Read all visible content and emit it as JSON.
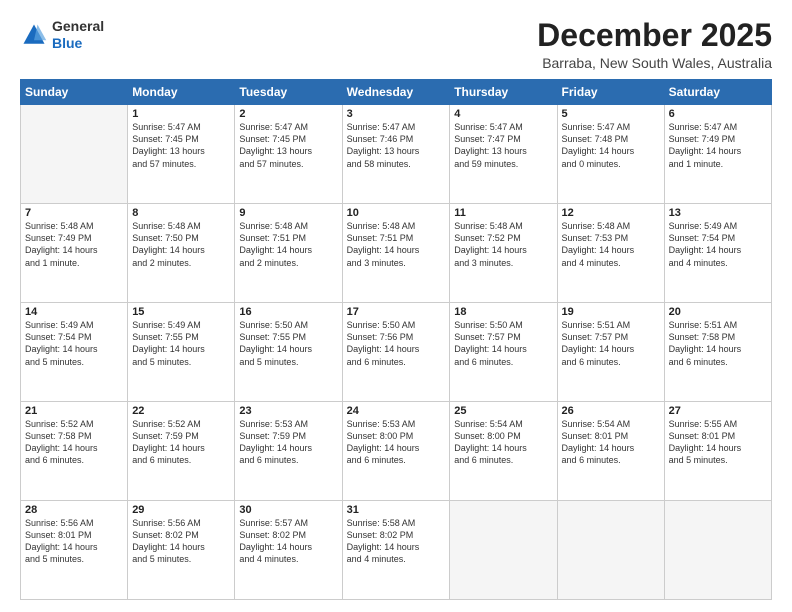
{
  "header": {
    "logo_general": "General",
    "logo_blue": "Blue",
    "title": "December 2025",
    "subtitle": "Barraba, New South Wales, Australia"
  },
  "days_of_week": [
    "Sunday",
    "Monday",
    "Tuesday",
    "Wednesday",
    "Thursday",
    "Friday",
    "Saturday"
  ],
  "weeks": [
    [
      {
        "day": "",
        "info": ""
      },
      {
        "day": "1",
        "info": "Sunrise: 5:47 AM\nSunset: 7:45 PM\nDaylight: 13 hours\nand 57 minutes."
      },
      {
        "day": "2",
        "info": "Sunrise: 5:47 AM\nSunset: 7:45 PM\nDaylight: 13 hours\nand 57 minutes."
      },
      {
        "day": "3",
        "info": "Sunrise: 5:47 AM\nSunset: 7:46 PM\nDaylight: 13 hours\nand 58 minutes."
      },
      {
        "day": "4",
        "info": "Sunrise: 5:47 AM\nSunset: 7:47 PM\nDaylight: 13 hours\nand 59 minutes."
      },
      {
        "day": "5",
        "info": "Sunrise: 5:47 AM\nSunset: 7:48 PM\nDaylight: 14 hours\nand 0 minutes."
      },
      {
        "day": "6",
        "info": "Sunrise: 5:47 AM\nSunset: 7:49 PM\nDaylight: 14 hours\nand 1 minute."
      }
    ],
    [
      {
        "day": "7",
        "info": "Sunrise: 5:48 AM\nSunset: 7:49 PM\nDaylight: 14 hours\nand 1 minute."
      },
      {
        "day": "8",
        "info": "Sunrise: 5:48 AM\nSunset: 7:50 PM\nDaylight: 14 hours\nand 2 minutes."
      },
      {
        "day": "9",
        "info": "Sunrise: 5:48 AM\nSunset: 7:51 PM\nDaylight: 14 hours\nand 2 minutes."
      },
      {
        "day": "10",
        "info": "Sunrise: 5:48 AM\nSunset: 7:51 PM\nDaylight: 14 hours\nand 3 minutes."
      },
      {
        "day": "11",
        "info": "Sunrise: 5:48 AM\nSunset: 7:52 PM\nDaylight: 14 hours\nand 3 minutes."
      },
      {
        "day": "12",
        "info": "Sunrise: 5:48 AM\nSunset: 7:53 PM\nDaylight: 14 hours\nand 4 minutes."
      },
      {
        "day": "13",
        "info": "Sunrise: 5:49 AM\nSunset: 7:54 PM\nDaylight: 14 hours\nand 4 minutes."
      }
    ],
    [
      {
        "day": "14",
        "info": "Sunrise: 5:49 AM\nSunset: 7:54 PM\nDaylight: 14 hours\nand 5 minutes."
      },
      {
        "day": "15",
        "info": "Sunrise: 5:49 AM\nSunset: 7:55 PM\nDaylight: 14 hours\nand 5 minutes."
      },
      {
        "day": "16",
        "info": "Sunrise: 5:50 AM\nSunset: 7:55 PM\nDaylight: 14 hours\nand 5 minutes."
      },
      {
        "day": "17",
        "info": "Sunrise: 5:50 AM\nSunset: 7:56 PM\nDaylight: 14 hours\nand 6 minutes."
      },
      {
        "day": "18",
        "info": "Sunrise: 5:50 AM\nSunset: 7:57 PM\nDaylight: 14 hours\nand 6 minutes."
      },
      {
        "day": "19",
        "info": "Sunrise: 5:51 AM\nSunset: 7:57 PM\nDaylight: 14 hours\nand 6 minutes."
      },
      {
        "day": "20",
        "info": "Sunrise: 5:51 AM\nSunset: 7:58 PM\nDaylight: 14 hours\nand 6 minutes."
      }
    ],
    [
      {
        "day": "21",
        "info": "Sunrise: 5:52 AM\nSunset: 7:58 PM\nDaylight: 14 hours\nand 6 minutes."
      },
      {
        "day": "22",
        "info": "Sunrise: 5:52 AM\nSunset: 7:59 PM\nDaylight: 14 hours\nand 6 minutes."
      },
      {
        "day": "23",
        "info": "Sunrise: 5:53 AM\nSunset: 7:59 PM\nDaylight: 14 hours\nand 6 minutes."
      },
      {
        "day": "24",
        "info": "Sunrise: 5:53 AM\nSunset: 8:00 PM\nDaylight: 14 hours\nand 6 minutes."
      },
      {
        "day": "25",
        "info": "Sunrise: 5:54 AM\nSunset: 8:00 PM\nDaylight: 14 hours\nand 6 minutes."
      },
      {
        "day": "26",
        "info": "Sunrise: 5:54 AM\nSunset: 8:01 PM\nDaylight: 14 hours\nand 6 minutes."
      },
      {
        "day": "27",
        "info": "Sunrise: 5:55 AM\nSunset: 8:01 PM\nDaylight: 14 hours\nand 5 minutes."
      }
    ],
    [
      {
        "day": "28",
        "info": "Sunrise: 5:56 AM\nSunset: 8:01 PM\nDaylight: 14 hours\nand 5 minutes."
      },
      {
        "day": "29",
        "info": "Sunrise: 5:56 AM\nSunset: 8:02 PM\nDaylight: 14 hours\nand 5 minutes."
      },
      {
        "day": "30",
        "info": "Sunrise: 5:57 AM\nSunset: 8:02 PM\nDaylight: 14 hours\nand 4 minutes."
      },
      {
        "day": "31",
        "info": "Sunrise: 5:58 AM\nSunset: 8:02 PM\nDaylight: 14 hours\nand 4 minutes."
      },
      {
        "day": "",
        "info": ""
      },
      {
        "day": "",
        "info": ""
      },
      {
        "day": "",
        "info": ""
      }
    ]
  ]
}
